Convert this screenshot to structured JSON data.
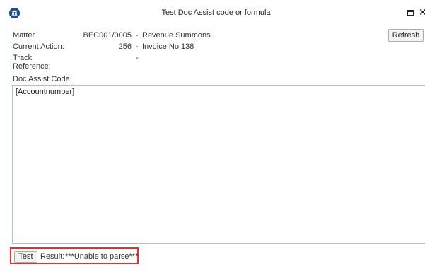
{
  "window": {
    "title": "Test Doc Assist code or formula",
    "maximize_icon": "maximize-icon",
    "close_glyph": "✕"
  },
  "info": {
    "matter": {
      "label": "Matter",
      "value": "BEC001/0005",
      "sep": "-",
      "desc": "Revenue Summons"
    },
    "current_action": {
      "label": "Current Action:",
      "value": "256",
      "sep": "-",
      "desc": "Invoice No:138"
    },
    "track_reference": {
      "label": "Track Reference:",
      "value": "",
      "sep": "-",
      "desc": ""
    }
  },
  "toolbar": {
    "refresh_label": "Refresh"
  },
  "code": {
    "label": "Doc Assist Code",
    "value": "[Accountnumber]"
  },
  "bottom": {
    "test_label": "Test",
    "result_label": "Result:",
    "result_value": "***Unable to parse***"
  },
  "colors": {
    "highlight": "#e0312e",
    "logo": "#1f4e9c",
    "input_border": "#abc1d9"
  }
}
